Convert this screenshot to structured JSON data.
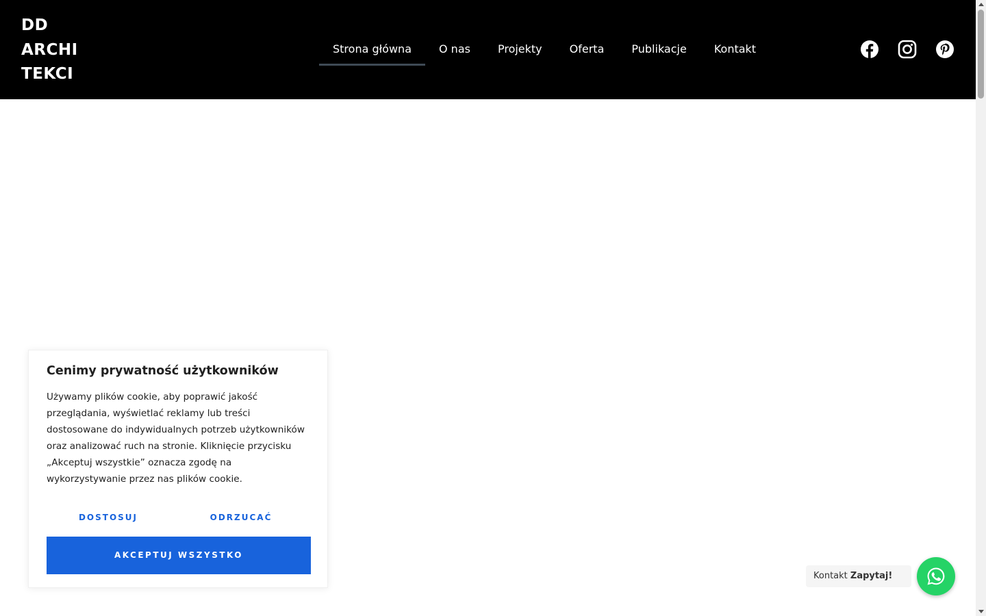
{
  "logo": {
    "lines": [
      "DD",
      "ARCHI",
      "TEKCI"
    ]
  },
  "nav": {
    "items": [
      {
        "label": "Strona główna",
        "active": true
      },
      {
        "label": "O nas"
      },
      {
        "label": "Projekty"
      },
      {
        "label": "Oferta"
      },
      {
        "label": "Publikacje"
      },
      {
        "label": "Kontakt"
      }
    ]
  },
  "social": {
    "icons": [
      "facebook-icon",
      "instagram-icon",
      "pinterest-icon"
    ]
  },
  "cookie": {
    "title": "Cenimy prywatność użytkowników",
    "text": "Używamy plików cookie, aby poprawić jakość przeglądania, wyświetlać reklamy lub treści dostosowane do indywidualnych potrzeb użytkowników oraz analizować ruch na stronie. Kliknięcie przycisku „Akceptuj wszystkie” oznacza zgodę na wykorzystywanie przez nas plików cookie.",
    "customize_label": "DOSTOSUJ",
    "reject_label": "ODRZUCAĆ",
    "accept_label": "AKCEPTUJ WSZYSTKO"
  },
  "whatsapp": {
    "label_prefix": "Kontakt",
    "label_bold": "Zapytaj!",
    "icon": "whatsapp-icon"
  },
  "colors": {
    "header_bg": "#000000",
    "accent_blue": "#1863dc",
    "whatsapp_green": "#25d366",
    "nav_underline": "#3f4a55"
  }
}
